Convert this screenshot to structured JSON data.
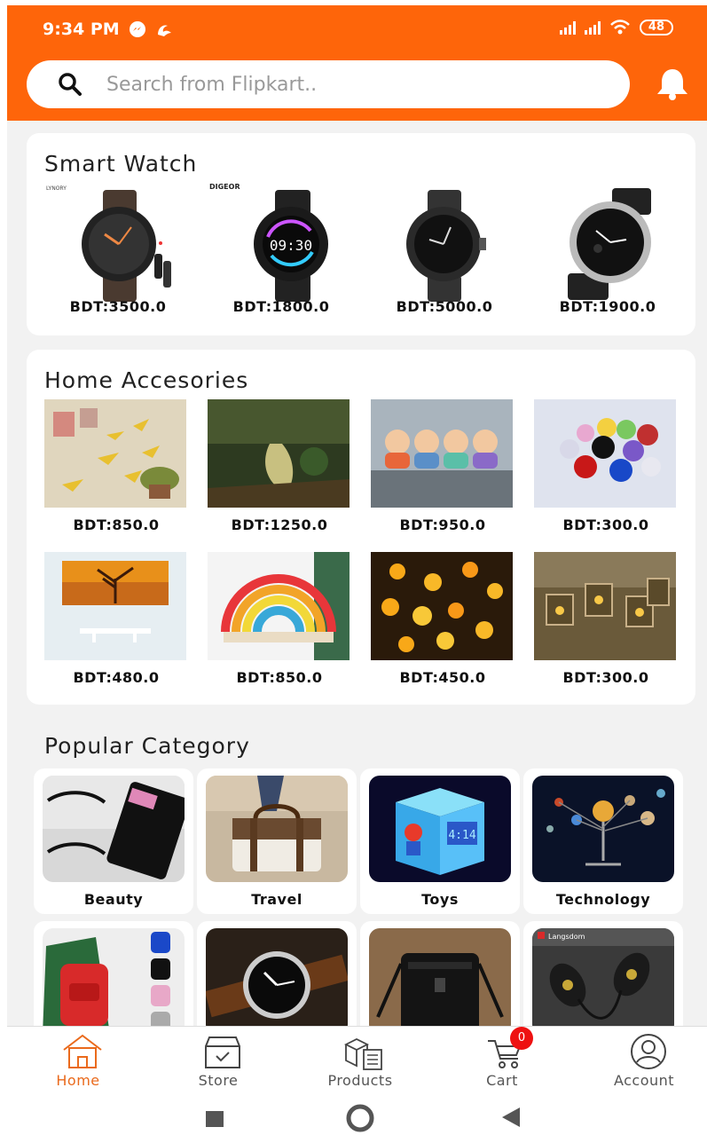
{
  "status": {
    "time": "9:34 PM",
    "battery": "48"
  },
  "search": {
    "placeholder": "Search from Flipkart.."
  },
  "smart_watch": {
    "title": "Smart Watch",
    "items": [
      {
        "brand": "LYNORY",
        "price": "BDT:3500.0"
      },
      {
        "brand": "DIGEOR",
        "price": "BDT:1800.0"
      },
      {
        "brand": "",
        "price": "BDT:5000.0"
      },
      {
        "brand": "",
        "price": "BDT:1900.0"
      }
    ],
    "watch_face_time": "09:30"
  },
  "home_accessories": {
    "title": "Home Accesories",
    "items": [
      {
        "price": "BDT:850.0"
      },
      {
        "price": "BDT:1250.0"
      },
      {
        "price": "BDT:950.0"
      },
      {
        "price": "BDT:300.0"
      },
      {
        "price": "BDT:480.0"
      },
      {
        "price": "BDT:850.0"
      },
      {
        "price": "BDT:450.0"
      },
      {
        "price": "BDT:300.0"
      }
    ]
  },
  "popular_category": {
    "title": "Popular Category",
    "items": [
      {
        "label": "Beauty"
      },
      {
        "label": "Travel"
      },
      {
        "label": "Toys"
      },
      {
        "label": "Technology"
      }
    ],
    "toy_clock_time": "4:14",
    "earphone_brand": "Langsdom"
  },
  "nav": {
    "items": [
      {
        "label": "Home",
        "icon": "home-icon"
      },
      {
        "label": "Store",
        "icon": "store-box-icon"
      },
      {
        "label": "Products",
        "icon": "products-icon"
      },
      {
        "label": "Cart",
        "icon": "cart-icon"
      },
      {
        "label": "Account",
        "icon": "account-icon"
      }
    ],
    "cart_count": "0"
  },
  "colors": {
    "accent": "#fe650a",
    "nav_active": "#ea6a1c"
  }
}
